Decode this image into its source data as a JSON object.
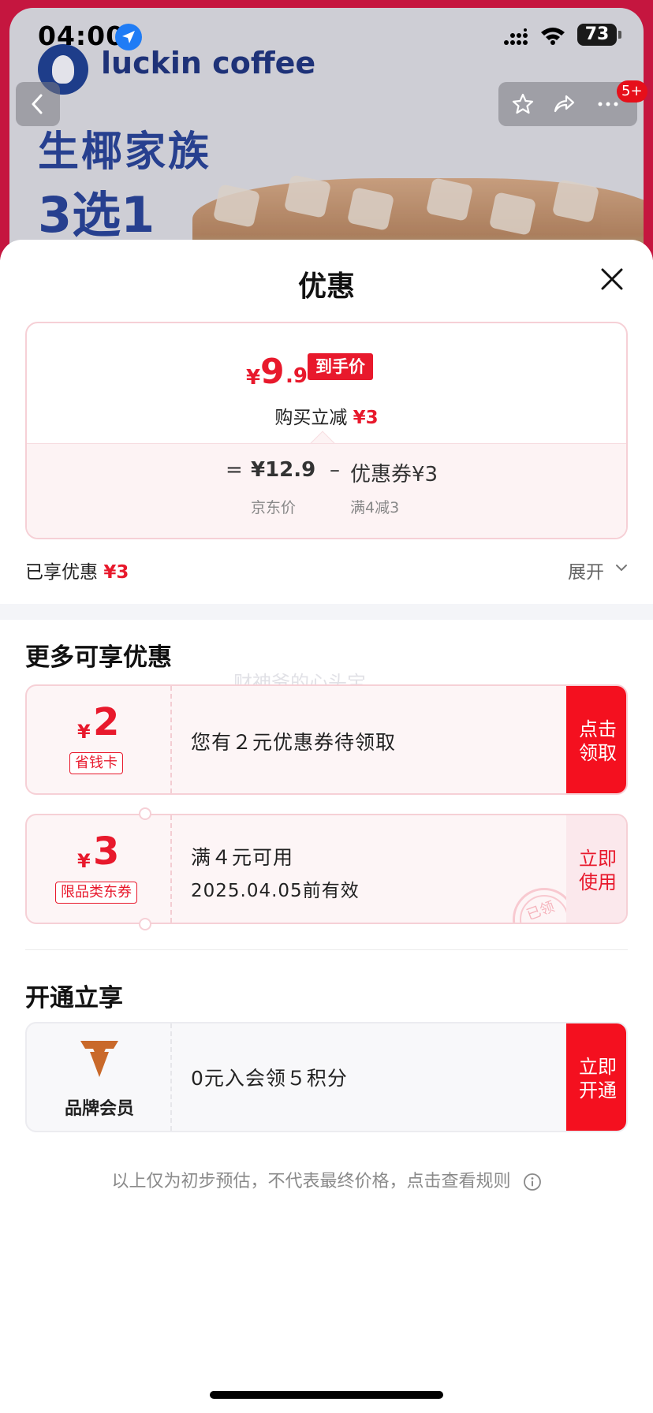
{
  "status_bar": {
    "time": "04:00",
    "battery": "73"
  },
  "background": {
    "brand_name": "luckin coffee",
    "promo_line1": "生椰家族",
    "promo_line2": "3选1",
    "more_badge": "5+"
  },
  "sheet": {
    "title": "优惠",
    "price": {
      "yen": "¥",
      "integer": "9",
      "decimal": ".9",
      "tag": "到手价",
      "reduce_label": "购买立减",
      "reduce_amount": "¥3"
    },
    "formula": {
      "equals": "=",
      "base_price": "¥12.9",
      "minus": "–",
      "coupon_text": "优惠券¥3",
      "base_label": "京东价",
      "coupon_label": "满4减3"
    },
    "enjoyed": {
      "label": "已享优惠",
      "amount": "¥3",
      "expand": "展开"
    },
    "more_section_title": "更多可享优惠",
    "watermark": "财神爷的心头宝",
    "coupons": [
      {
        "yen": "¥",
        "value": "2",
        "tag": "省钱卡",
        "text": "您有２元优惠券待领取",
        "action_line1": "点击",
        "action_line2": "领取"
      },
      {
        "yen": "¥",
        "value": "3",
        "tag": "限品类东券",
        "text_line1": "满４元可用",
        "text_line2": "2025.04.05前有效",
        "action_line1": "立即",
        "action_line2": "使用",
        "stamp": "已领"
      }
    ],
    "open_section_title": "开通立享",
    "member": {
      "label": "品牌会员",
      "text": "0元入会领５积分",
      "action_line1": "立即",
      "action_line2": "开通"
    },
    "footnote": "以上仅为初步预估，不代表最终价格，点击查看规则"
  },
  "colors": {
    "accent": "#e8192c",
    "action_red": "#f4101f",
    "brand_blue": "#27408f"
  }
}
